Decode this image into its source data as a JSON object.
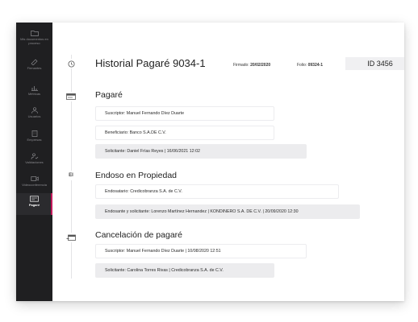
{
  "sidebar": {
    "items": [
      {
        "label": "Mis documentos en proceso",
        "icon": "folder-icon",
        "active": false
      },
      {
        "label": "Firmantes",
        "icon": "signature-icon",
        "active": false
      },
      {
        "label": "Métricas",
        "icon": "chart-icon",
        "active": false
      },
      {
        "label": "Usuarios",
        "icon": "user-icon",
        "active": false
      },
      {
        "label": "Empresas",
        "icon": "building-icon",
        "active": false
      },
      {
        "label": "Validaciones",
        "icon": "person-check-icon",
        "active": false
      },
      {
        "label": "Videoconferencia",
        "icon": "video-icon",
        "active": false
      },
      {
        "label": "Pagaré",
        "icon": "promissory-note-icon",
        "active": true
      }
    ]
  },
  "header": {
    "title": "Historial Pagaré  9034-1",
    "signed_label": "Firmado:",
    "signed_value": "20/02/2020",
    "folio_label": "Folio:",
    "folio_value": "09324-1",
    "id_badge": "ID 3456"
  },
  "sections": {
    "pagare": {
      "title": "Pagaré",
      "suscriptor": "Suscriptor: Manuel Fernando Díez Duarte",
      "beneficiario": "Beneficiario:  Banco S.A.DE C.V.",
      "solicitante": "Solicitante: Daniel Frías Reyes | 16/06/2021 12:02"
    },
    "endoso": {
      "title": "Endoso en Propiedad",
      "icon_text": "EI",
      "endosatario": "Endosatario: Credicobranza S.A. de C.V.",
      "endosante": "Endosante y solicitante: Lorenzo Martínez Hernandez | KONDINERO S.A. DE C.V. | 20/09/2020 12:30"
    },
    "cancelacion": {
      "title": "Cancelación de pagaré",
      "suscriptor": "Suscriptor: Manuel Fernando Díez Duarte | 10/08/2020 12:51",
      "solicitante": "Solicitante: Carolina Torres Rivas | Credicobranza S.A. de C.V."
    }
  },
  "colors": {
    "sidebar_bg": "#1f1f21",
    "accent": "#c2185b",
    "shaded_field": "#ececee"
  }
}
